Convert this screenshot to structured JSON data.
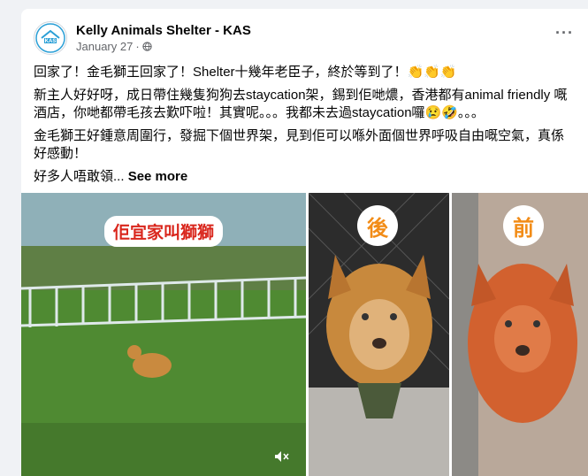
{
  "post": {
    "page_name": "Kelly Animals Shelter - KAS",
    "date": "January 27",
    "privacy_icon": "globe-icon",
    "options_icon": "more-options-icon",
    "avatar_text": "KAS"
  },
  "content": {
    "line1": "回家了！金毛獅王回家了！Shelter十幾年老臣子，終於等到了！👏👏👏",
    "line2": "新主人好好呀，成日帶住幾隻狗狗去staycation架，錫到佢哋燶，香港都有animal friendly 嘅酒店，你哋都帶毛孩去歎吓啦！其實呢。。。我都未去過staycation囉😢🤣。。。",
    "line3": "金毛獅王好鍾意周圍行，發掘下個世界架，見到佢可以喺外面個世界呼吸自由嘅空氣，真係好感動！",
    "line4": "好多人唔敢領...",
    "see_more": "See more"
  },
  "media": {
    "caption_left": "佢宜家叫獅獅",
    "label_after": "後",
    "label_before": "前",
    "mute_icon": "volume-muted-icon"
  },
  "colors": {
    "caption_text": "#d9261c",
    "label_text": "#f28c17"
  }
}
